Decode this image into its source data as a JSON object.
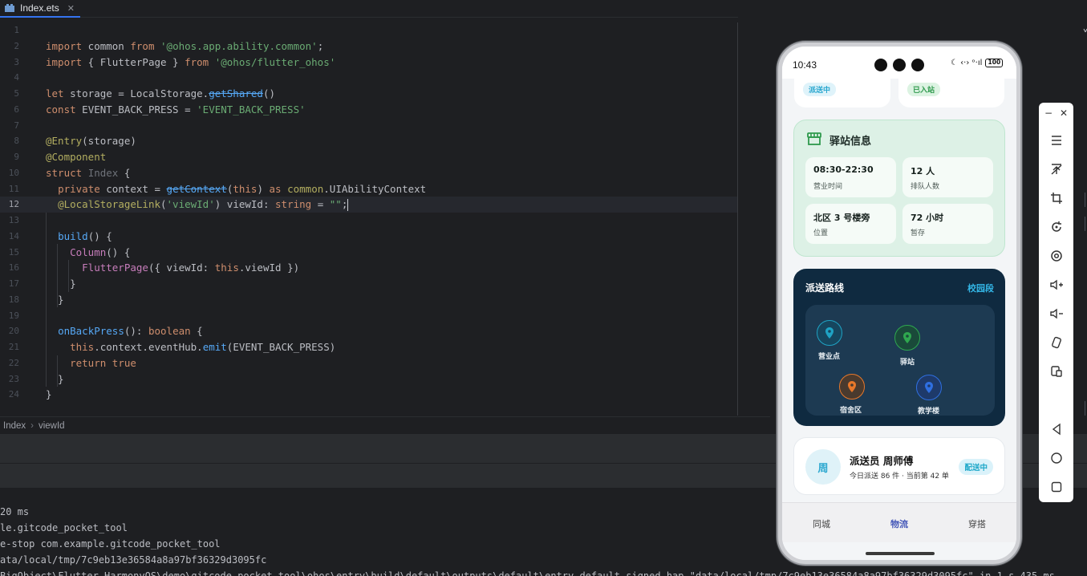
{
  "tab": {
    "label": "Index.ets",
    "close": "✕"
  },
  "code": {
    "line_numbers": [
      "1",
      "2",
      "3",
      "4",
      "5",
      "6",
      "7",
      "8",
      "9",
      "10",
      "11",
      "12",
      "13",
      "14",
      "15",
      "16",
      "17",
      "18",
      "19",
      "20",
      "21",
      "22",
      "23",
      "24"
    ],
    "lines": [
      "",
      "import common from '@ohos.app.ability.common';",
      "import { FlutterPage } from '@ohos/flutter_ohos'",
      "",
      "let storage = LocalStorage.getShared()",
      "const EVENT_BACK_PRESS = 'EVENT_BACK_PRESS'",
      "",
      "@Entry(storage)",
      "@Component",
      "struct Index {",
      "  private context = getContext(this) as common.UIAbilityContext",
      "  @LocalStorageLink('viewId') viewId: string = \"\";",
      "",
      "  build() {",
      "    Column() {",
      "      FlutterPage({ viewId: this.viewId })",
      "    }",
      "  }",
      "",
      "  onBackPress(): boolean {",
      "    this.context.eventHub.emit(EVENT_BACK_PRESS)",
      "    return true",
      "  }",
      "}"
    ]
  },
  "breadcrumb": [
    "Index",
    "viewId"
  ],
  "log": [
    "20 ms",
    "le.gitcode_pocket_tool",
    "e-stop com.example.gitcode_pocket_tool",
    "ata/local/tmp/7c9eb13e36584a8a97bf36329d3095fc",
    "BigObject\\Flutter_HarmonyOS\\demo\\gitcode_pocket_tool\\ohos\\entry\\build\\default\\outputs\\default\\entry-default-signed.hap \"data/local/tmp/7c9eb13e36584a8a97bf36329d3095fc\" in 1 s 435 ms"
  ],
  "phone": {
    "time": "10:43",
    "status_icons": "☾ ‹·› ᵒ‧ıl",
    "battery": "100",
    "top_pills": [
      "派送中",
      "已入站"
    ],
    "station": {
      "title": "驿站信息",
      "cells": [
        {
          "main": "08:30-22:30",
          "sub": "营业时间"
        },
        {
          "main": "12 人",
          "sub": "排队人数"
        },
        {
          "main": "北区 3 号楼旁",
          "sub": "位置"
        },
        {
          "main": "72 小时",
          "sub": "暂存"
        }
      ]
    },
    "route": {
      "title": "派送路线",
      "link": "校园段",
      "nodes": [
        {
          "label": "营业点",
          "color": "#1fa3c4"
        },
        {
          "label": "驿站",
          "color": "#2fa84f"
        },
        {
          "label": "宿舍区",
          "color": "#e8782a"
        },
        {
          "label": "教学楼",
          "color": "#2f6fe0"
        }
      ]
    },
    "courier": {
      "avatar": "周",
      "name": "派送员 周师傅",
      "sub": "今日派送 86 件 · 当前第 42 单",
      "badge": "配送中"
    },
    "tabs": [
      "同城",
      "物流",
      "穿搭"
    ],
    "active_tab": "物流"
  },
  "emulator_toolbar": {
    "window": [
      "−",
      "✕"
    ],
    "tools": [
      "menu-icon",
      "pin-top-icon",
      "crop-icon",
      "rotate-icon",
      "screenshot-icon",
      "volume-up-icon",
      "volume-down-icon",
      "shake-icon",
      "multi-window-icon",
      "back-icon",
      "home-icon",
      "recents-icon"
    ]
  }
}
